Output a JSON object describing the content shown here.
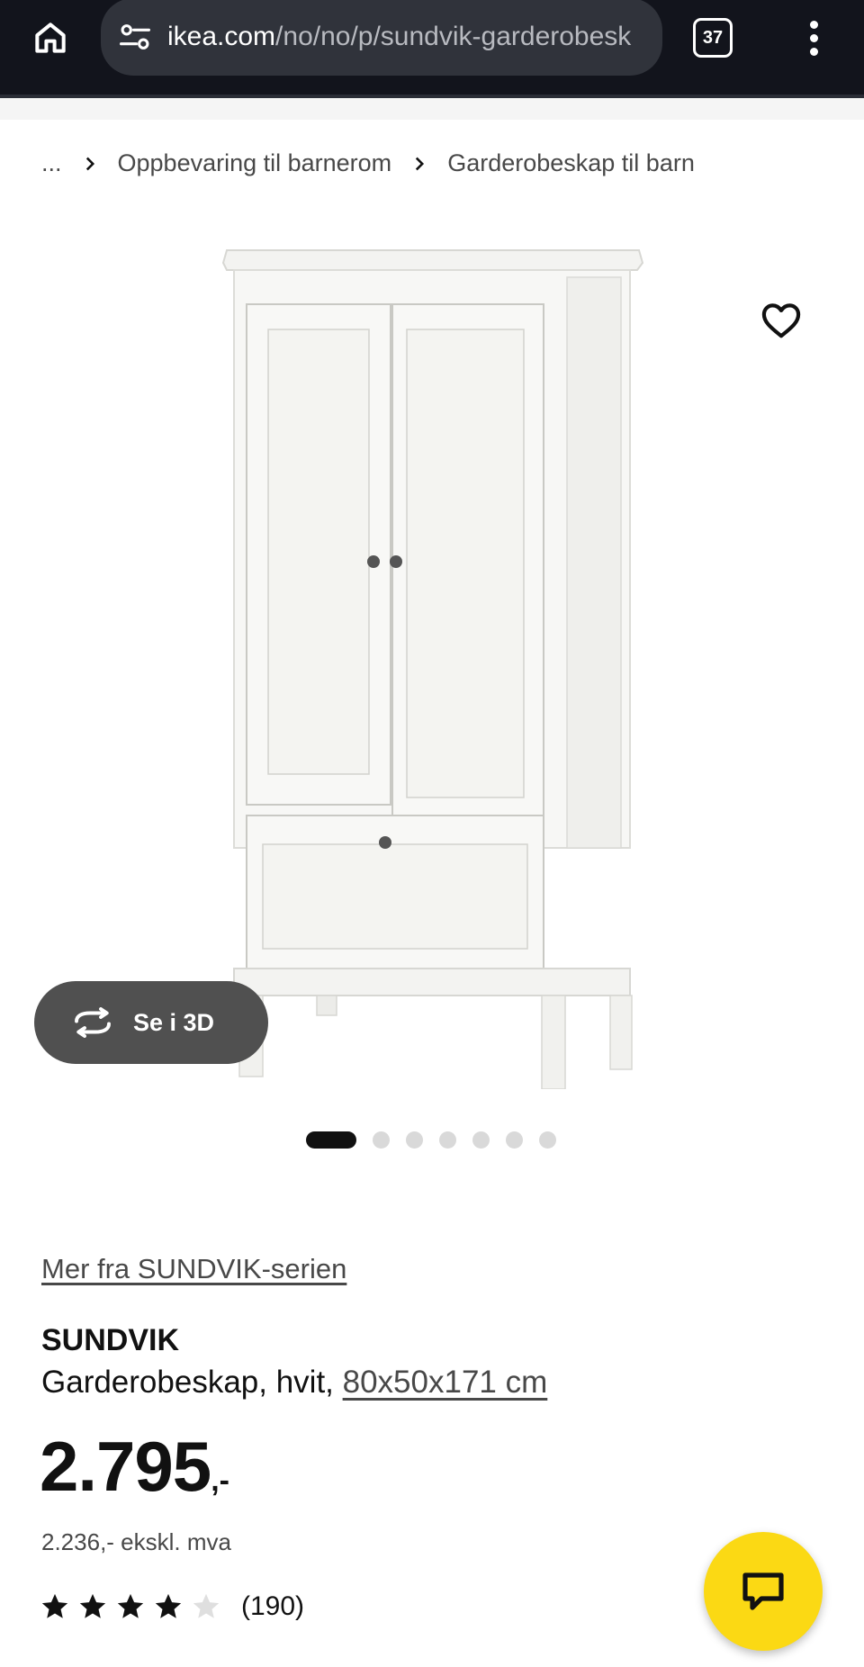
{
  "browser": {
    "url_host": "ikea.com",
    "url_path": "/no/no/p/sundvik-garderobesk",
    "tab_count": "37"
  },
  "breadcrumb": {
    "ellipsis": "...",
    "items": [
      "Oppbevaring til barnerom",
      "Garderobeskap til barn"
    ]
  },
  "gallery": {
    "view_3d_label": "Se i 3D",
    "slide_count": 7,
    "active_slide": 1
  },
  "product": {
    "series_link": "Mer fra SUNDVIK-serien",
    "name": "SUNDVIK",
    "description": "Garderobeskap, hvit, ",
    "measurements": "80x50x171 cm",
    "price": "2.795",
    "price_suffix": ",-",
    "price_excl_vat": "2.236,- ekskl. mva",
    "rating": 4,
    "rating_max": 5,
    "review_count": "(190)"
  },
  "colors": {
    "chrome_bg": "#12141c",
    "chat_button": "#fbd914",
    "text_secondary": "#484848"
  },
  "icons": {
    "home": "home-icon",
    "site_settings": "tune-icon",
    "tabs": "tabs-icon",
    "menu": "more-vert-icon",
    "favourite": "heart-icon",
    "rotate": "rotate-3d-icon",
    "chat": "chat-icon"
  }
}
